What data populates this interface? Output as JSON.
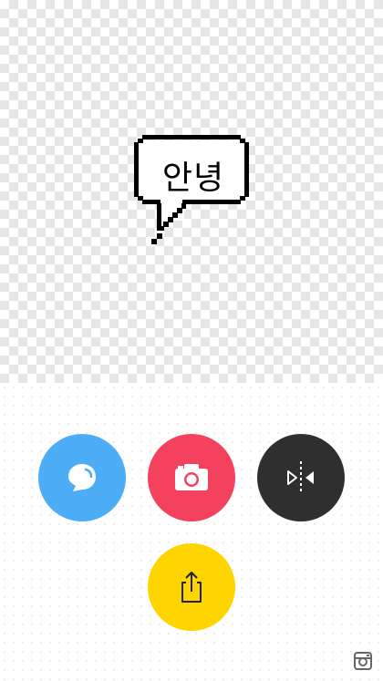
{
  "canvas": {
    "bubble_text": "안녕"
  },
  "actions": {
    "balloon": {
      "icon": "speech-bubble-icon",
      "color": "#4DADF7"
    },
    "camera": {
      "icon": "camera-icon",
      "color": "#F4425E"
    },
    "flip": {
      "icon": "flip-horizontal-icon",
      "color": "#2F2F2F"
    },
    "share": {
      "icon": "share-icon",
      "color": "#FFD500"
    }
  },
  "footer": {
    "instagram_icon": "instagram-icon"
  }
}
